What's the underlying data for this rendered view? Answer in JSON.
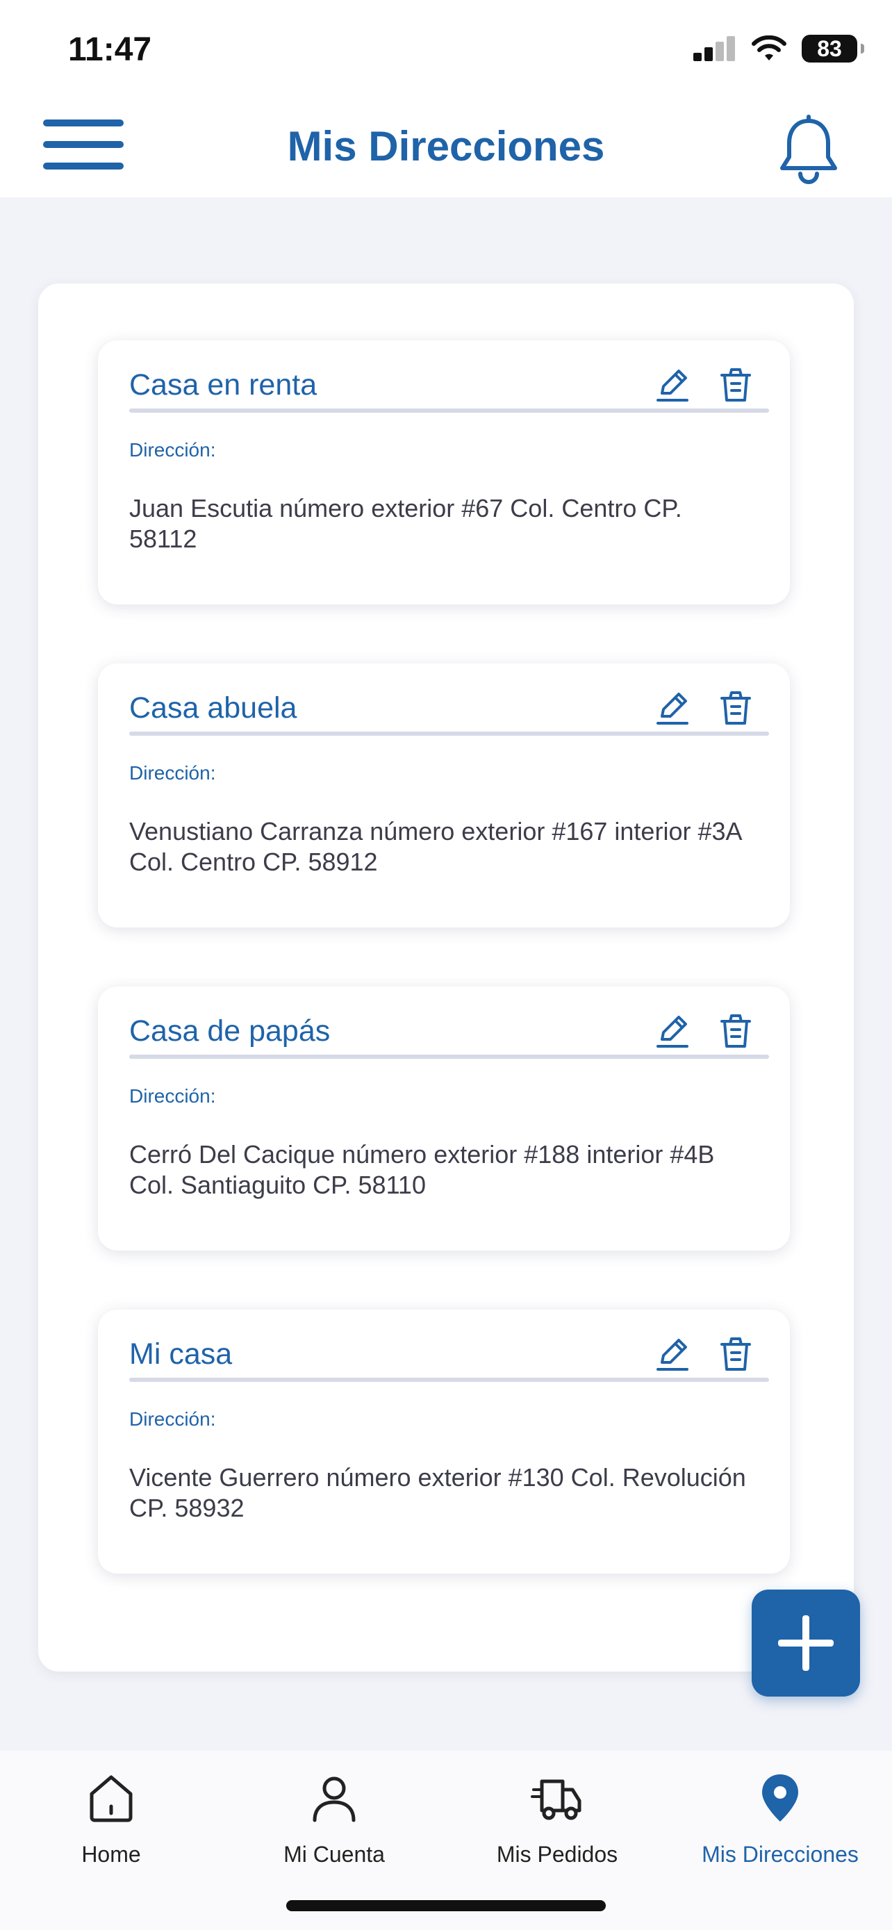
{
  "status": {
    "time": "11:47",
    "battery": "83"
  },
  "header": {
    "title": "Mis Direcciones"
  },
  "addresses": [
    {
      "name": "Casa en renta",
      "label": "Dirección:",
      "text": "Juan Escutia número exterior #67 Col. Centro CP. 58112"
    },
    {
      "name": "Casa abuela",
      "label": "Dirección:",
      "text": "Venustiano Carranza número exterior #167 interior #3A Col. Centro CP. 58912"
    },
    {
      "name": "Casa de papás",
      "label": "Dirección:",
      "text": "Cerró Del Cacique número exterior #188 interior #4B Col. Santiaguito CP. 58110"
    },
    {
      "name": "Mi casa",
      "label": "Dirección:",
      "text": "Vicente Guerrero número exterior #130 Col. Revolución CP. 58932"
    }
  ],
  "tabs": [
    {
      "label": "Home",
      "icon": "home-icon"
    },
    {
      "label": "Mi Cuenta",
      "icon": "user-icon"
    },
    {
      "label": "Mis Pedidos",
      "icon": "truck-icon"
    },
    {
      "label": "Mis Direcciones",
      "icon": "location-pin-icon"
    }
  ],
  "colors": {
    "accent": "#1f63a9",
    "background": "#f2f3f8",
    "divider": "#d6d9e6"
  }
}
